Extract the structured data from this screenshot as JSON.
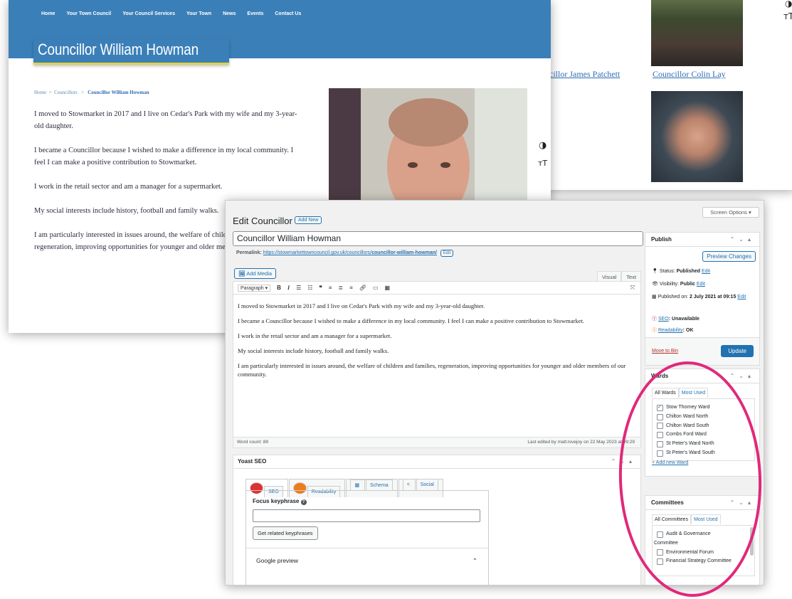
{
  "grid_window": {
    "captions": [
      "Councillor James Patchett",
      "Councillor Colin Lay"
    ],
    "caption_partial": "cillor James Patchett",
    "a11y": {
      "contrast_icon": "◑",
      "text_size_icon": "тT"
    }
  },
  "site": {
    "nav": [
      "Home",
      "Your Town Council",
      "Your Council Services",
      "Your Town",
      "News",
      "Events",
      "Contact Us"
    ],
    "title": "Councillor William Howman",
    "breadcrumb": {
      "home": "Home",
      "sep1": ">",
      "councillors": "Councillors",
      "sep2": ">",
      "current": "Councillor William Howman"
    },
    "bio": [
      "I moved to Stowmarket in 2017 and I live on Cedar's Park with my wife and my 3-year-old daughter.",
      "I became a Councillor because I wished to make a difference in my local community. I feel I can make a positive contribution to Stowmarket.",
      "I work in the retail sector and am a manager for a supermarket.",
      "My social interests include history, football and family walks.",
      "I am particularly interested in issues around, the welfare of children and families, regeneration, improving opportunities for younger and older members of our community."
    ],
    "side_icons": {
      "contrast": "◑",
      "text_size": "тT"
    }
  },
  "wp": {
    "screen_options": "Screen Options ▾",
    "heading": "Edit Councillor",
    "add_new": "Add New",
    "post_title": "Councillor William Howman",
    "permalink_label": "Permalink:",
    "permalink_base": "https://stowmarkettowncouncil.gov.uk/councillors/",
    "permalink_slug": "councillor-william-howman/",
    "permalink_edit": "Edit",
    "add_media": "Add Media",
    "tab_visual": "Visual",
    "tab_text": "Text",
    "format_select": "Paragraph",
    "content": [
      "I moved to Stowmarket in 2017 and I live on Cedar's Park with my wife and my 3-year-old daughter.",
      "I became a Councillor because I wished to make a difference in my local community. I feel I can make a positive contribution to Stowmarket.",
      "I work in the retail sector and am a manager for a supermarket.",
      "My social interests include history, football and family walks.",
      "I am particularly interested in issues around, the welfare of children and families, regeneration, improving opportunities for younger and older members of our community."
    ],
    "word_count": "Word count: 89",
    "last_edited": "Last edited by matt.lovejoy on 22 May 2023 at 09:29",
    "yoast": {
      "title": "Yoast SEO",
      "tabs": [
        "SEO",
        "Readability",
        "Schema",
        "Social"
      ],
      "focus_label": "Focus keyphrase",
      "related_button": "Get related keyphrases",
      "google_preview": "Google preview"
    },
    "publish": {
      "title": "Publish",
      "preview": "Preview Changes",
      "status_label": "Status:",
      "status_value": "Published",
      "visibility_label": "Visibility:",
      "visibility_value": "Public",
      "edit": "Edit",
      "published_label": "Published on:",
      "published_value": "2 July 2021 at 09:15",
      "seo_label": "SEO",
      "seo_value": ": Unavailable",
      "readability_label": "Readability",
      "readability_value": ": OK",
      "move_to_bin": "Move to Bin",
      "update": "Update"
    },
    "wards": {
      "title": "Wards",
      "tab_all": "All Wards",
      "tab_used": "Most Used",
      "items": [
        {
          "label": "Stow Thorney Ward",
          "checked": true
        },
        {
          "label": "Chilton Ward North",
          "checked": false
        },
        {
          "label": "Chilton Ward South",
          "checked": false
        },
        {
          "label": "Combs Ford Ward",
          "checked": false
        },
        {
          "label": "St Peter's Ward North",
          "checked": false
        },
        {
          "label": "St Peter's Ward South",
          "checked": false
        }
      ],
      "add_new": "+ Add new Ward"
    },
    "committees": {
      "title": "Committees",
      "tab_all": "All Committees",
      "tab_used": "Most Used",
      "items": [
        "Audit & Governance",
        "Committee",
        "Environmental Forum",
        "Financial Strategy Committee"
      ]
    }
  },
  "colors": {
    "brand_blue": "#3b7fb8",
    "wp_blue": "#2271b1",
    "highlight": "#e0297a",
    "title_underline": "#e3d24a"
  }
}
